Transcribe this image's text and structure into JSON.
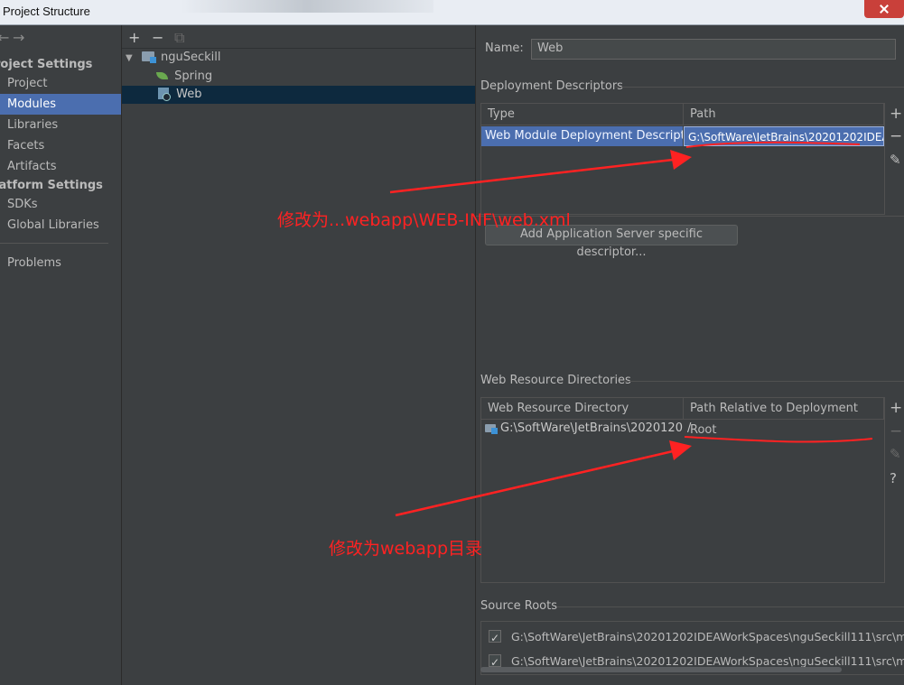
{
  "window": {
    "title": "Project Structure"
  },
  "nav": {
    "back_icon": "arrow-left-icon",
    "forward_icon": "arrow-right-icon",
    "project_settings_header": "roject Settings",
    "project_settings_items": [
      "Project",
      "Modules",
      "Libraries",
      "Facets",
      "Artifacts"
    ],
    "platform_settings_header": "latform Settings",
    "platform_settings_items": [
      "SDKs",
      "Global Libraries"
    ],
    "problems": "Problems",
    "selected": "Modules"
  },
  "tree": {
    "toolbar": {
      "add": "+",
      "remove": "−",
      "copy": "⧉"
    },
    "root": "nguSeckill",
    "children": [
      "Spring",
      "Web"
    ],
    "selected": "Web"
  },
  "details": {
    "name_label": "Name:",
    "name_value": "Web",
    "deployment_descriptors": {
      "title": "Deployment Descriptors",
      "columns": [
        "Type",
        "Path"
      ],
      "rows": [
        {
          "type": "Web Module Deployment Descriptor",
          "path": "G:\\SoftWare\\JetBrains\\20201202IDEA"
        }
      ],
      "add_server_button": "Add Application Server specific descriptor..."
    },
    "web_resource_directories": {
      "title": "Web Resource Directories",
      "columns": [
        "Web Resource Directory",
        "Path Relative to Deployment Root"
      ],
      "rows": [
        {
          "directory": "G:\\SoftWare\\JetBrains\\2020120...",
          "relative_path": "/"
        }
      ]
    },
    "source_roots": {
      "title": "Source Roots",
      "rows": [
        "G:\\SoftWare\\JetBrains\\20201202IDEAWorkSpaces\\nguSeckill111\\src\\main\\ja",
        "G:\\SoftWare\\JetBrains\\20201202IDEAWorkSpaces\\nguSeckill111\\src\\main\\r"
      ]
    }
  },
  "side_buttons": {
    "add": "+",
    "remove": "−",
    "edit": "✎",
    "help": "?"
  },
  "annotations": {
    "first": "修改为...webapp\\WEB-INF\\web.xml",
    "second": "修改为webapp目录",
    "color": "#ff2222"
  }
}
